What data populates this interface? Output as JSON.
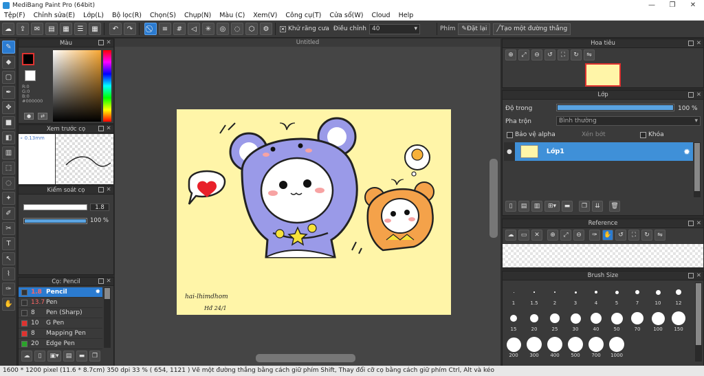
{
  "window": {
    "title": "MediBang Paint Pro (64bit)",
    "min": "—",
    "max": "❐",
    "close": "✕"
  },
  "menu": [
    "Tệp(F)",
    "Chỉnh sửa(E)",
    "Lớp(L)",
    "Bộ lọc(R)",
    "Chọn(S)",
    "Chụp(N)",
    "Màu (C)",
    "Xem(V)",
    "Công cụ(T)",
    "Cửa sổ(W)",
    "Cloud",
    "Help"
  ],
  "toolbar": {
    "antialias_label": "Khử răng cưa",
    "adjust_label": "Điều chỉnh",
    "adjust_value": "40",
    "key_label": "Phím",
    "reset_label": "Đặt lại",
    "line_label": "Tạo một đường thẳng"
  },
  "color_panel": {
    "title": "Màu",
    "r": "R:0",
    "g": "G:0",
    "b": "B:0",
    "hex": "#000000",
    "fg": "#000000",
    "bg": "#ffffff"
  },
  "preview_panel": {
    "title": "Xem trước cọ",
    "size": "0.13mm"
  },
  "brush_control": {
    "title": "Kiểm soát cọ",
    "size_value": "1.8",
    "opacity_value": "100 %",
    "opacity": 1.0
  },
  "brush_list": {
    "title": "Cọ: Pencil",
    "items": [
      {
        "size": "1.8",
        "name": "Pencil",
        "color": "#333333",
        "selected": true
      },
      {
        "size": "13.7",
        "name": "Pen",
        "color": "#333333"
      },
      {
        "size": "8",
        "name": "Pen (Sharp)",
        "color": "#333333"
      },
      {
        "size": "10",
        "name": "G Pen",
        "color": "#e0322f"
      },
      {
        "size": "8",
        "name": "Mapping Pen",
        "color": "#e0322f"
      },
      {
        "size": "20",
        "name": "Edge Pen",
        "color": "#2aa32a"
      }
    ]
  },
  "document": {
    "tab": "Untitled",
    "signature": "hai-lhimdhom",
    "date": "Hđ 24/1"
  },
  "navigator": {
    "title": "Hoa tiêu"
  },
  "layer_panel": {
    "title": "Lớp",
    "opacity_label": "Độ trong",
    "opacity_value": "100 %",
    "opacity": 1.0,
    "blend_label": "Pha trộn",
    "blend_value": "Bình thường",
    "protect_alpha": "Bảo vệ alpha",
    "clip": "Xén bớt",
    "lock": "Khóa",
    "layer_name": "Lớp1"
  },
  "reference": {
    "title": "Reference"
  },
  "brush_size": {
    "title": "Brush Size",
    "sizes": [
      "1",
      "1.5",
      "2",
      "3",
      "4",
      "5",
      "7",
      "10",
      "12",
      "15",
      "20",
      "25",
      "30",
      "40",
      "50",
      "70",
      "100",
      "150",
      "200",
      "300",
      "400",
      "500",
      "700",
      "1000"
    ]
  },
  "status": {
    "text": "1600 * 1200 pixel   (11.6 * 8.7cm)  350 dpi   33 %   ( 654, 1121 )  Vẽ một đường thẳng bằng cách giữ phím Shift, Thay đổi cỡ cọ bằng cách giữ phím Ctrl, Alt và kéo"
  },
  "colors": {
    "accent": "#2b7bd0",
    "bar": "#5aa3e0",
    "canvas": "#fff5a8",
    "mouse": "#9a9ae8",
    "bear": "#f4a24a"
  }
}
